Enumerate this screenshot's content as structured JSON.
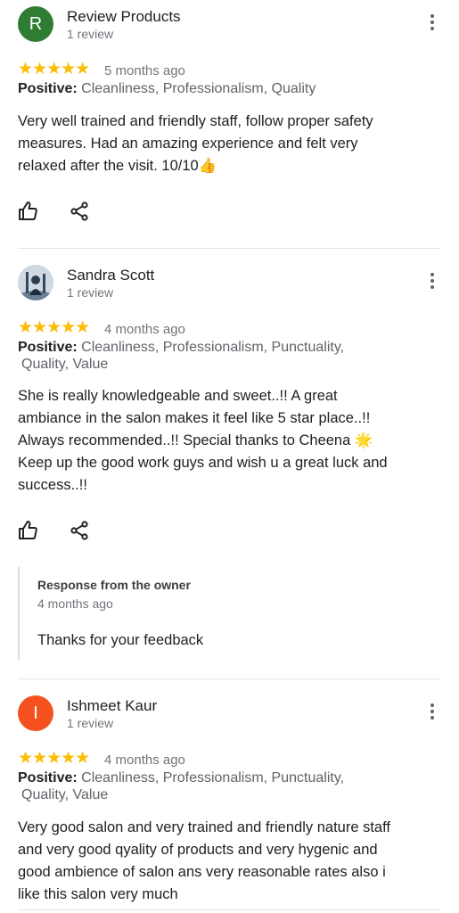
{
  "reviews": [
    {
      "avatar_letter": "R",
      "avatar_color": "#2e7d32",
      "name": "Review Products",
      "subinfo": "1 review",
      "stars": "★★★★★",
      "rating": 5,
      "time": "5 months ago",
      "attrs_label": "Positive:",
      "attrs_line1": " Cleanliness, Professionalism, Quality",
      "attrs_line2": "",
      "text_lines": [
        "Very well trained and friendly staff, follow proper safety",
        "measures. Had an amazing experience and felt very",
        "relaxed after the visit. 10/10👍"
      ]
    },
    {
      "avatar_letter": "",
      "avatar_color": "#7a8fa6",
      "name": "Sandra Scott",
      "subinfo": "1 review",
      "stars": "★★★★★",
      "rating": 5,
      "time": "4 months ago",
      "attrs_label": "Positive:",
      "attrs_line1": " Cleanliness, Professionalism, Punctuality,",
      "attrs_line2": "Quality, Value",
      "text_lines": [
        "She is really knowledgeable and sweet..!! A great",
        "ambiance in the salon makes it feel like 5 star place..!!",
        "Always recommended..!! Special thanks to Cheena 🌟",
        "Keep up the good work guys and wish u a great luck and",
        "success..!!"
      ],
      "owner_response": {
        "title": "Response from the owner",
        "time": "4 months ago",
        "text": "Thanks for your feedback"
      }
    },
    {
      "avatar_letter": "I",
      "avatar_color": "#f4511e",
      "name": "Ishmeet Kaur",
      "subinfo": "1 review",
      "stars": "★★★★★",
      "rating": 5,
      "time": "4 months ago",
      "attrs_label": "Positive:",
      "attrs_line1": " Cleanliness, Professionalism, Punctuality,",
      "attrs_line2": "Quality, Value",
      "text_lines": [
        "Very good salon and very trained and friendly nature staff",
        "and very good qyality of products and very hygenic and",
        "good ambience of salon ans very reasonable rates also i",
        "like this salon very much"
      ]
    }
  ],
  "icons": {
    "like": "thumb-up-icon",
    "share": "share-icon",
    "menu": "more-vert-icon"
  }
}
